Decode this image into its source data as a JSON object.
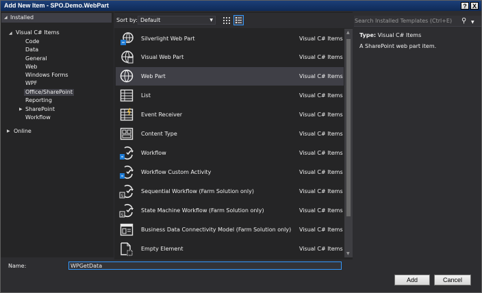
{
  "window": {
    "title": "Add New Item - SPO.Demo.WebPart",
    "help_glyph": "?",
    "close_glyph": "X"
  },
  "tree": {
    "header": "Installed",
    "items": [
      {
        "label": "Visual C# Items"
      },
      {
        "label": "Code"
      },
      {
        "label": "Data"
      },
      {
        "label": "General"
      },
      {
        "label": "Web"
      },
      {
        "label": "Windows Forms"
      },
      {
        "label": "WPF"
      },
      {
        "label": "Office/SharePoint"
      },
      {
        "label": "Reporting"
      },
      {
        "label": "SharePoint"
      },
      {
        "label": "Workflow"
      }
    ],
    "online": "Online"
  },
  "toolbar": {
    "sort_label": "Sort by:",
    "sort_value": "Default"
  },
  "templates": [
    {
      "name": "Silverlight Web Part",
      "type": "Visual C# Items",
      "icon": "silverlight-webpart-icon"
    },
    {
      "name": "Visual Web Part",
      "type": "Visual C# Items",
      "icon": "visual-webpart-icon"
    },
    {
      "name": "Web Part",
      "type": "Visual C# Items",
      "icon": "webpart-icon"
    },
    {
      "name": "List",
      "type": "Visual C# Items",
      "icon": "list-icon"
    },
    {
      "name": "Event Receiver",
      "type": "Visual C# Items",
      "icon": "event-receiver-icon"
    },
    {
      "name": "Content Type",
      "type": "Visual C# Items",
      "icon": "content-type-icon"
    },
    {
      "name": "Workflow",
      "type": "Visual C# Items",
      "icon": "workflow-icon"
    },
    {
      "name": "Workflow Custom Activity",
      "type": "Visual C# Items",
      "icon": "workflow-activity-icon"
    },
    {
      "name": "Sequential Workflow (Farm Solution only)",
      "type": "Visual C# Items",
      "icon": "sequential-workflow-icon"
    },
    {
      "name": "State Machine Workflow (Farm Solution only)",
      "type": "Visual C# Items",
      "icon": "state-machine-workflow-icon"
    },
    {
      "name": "Business Data Connectivity Model (Farm Solution only)",
      "type": "Visual C# Items",
      "icon": "bdc-model-icon"
    },
    {
      "name": "Empty Element",
      "type": "Visual C# Items",
      "icon": "empty-element-icon"
    }
  ],
  "selected_index": 2,
  "search": {
    "placeholder": "Search Installed Templates (Ctrl+E)"
  },
  "details": {
    "type_label": "Type:",
    "type_value": "Visual C# Items",
    "description": "A SharePoint web part item."
  },
  "footer": {
    "name_label": "Name:",
    "name_value": "WPGetData",
    "add_label": "Add",
    "cancel_label": "Cancel"
  },
  "colors": {
    "accent": "#3399ff",
    "selection": "#3f3f46",
    "background": "#2d2d30",
    "panel": "#252526",
    "titlebar": "#1c3f78"
  }
}
